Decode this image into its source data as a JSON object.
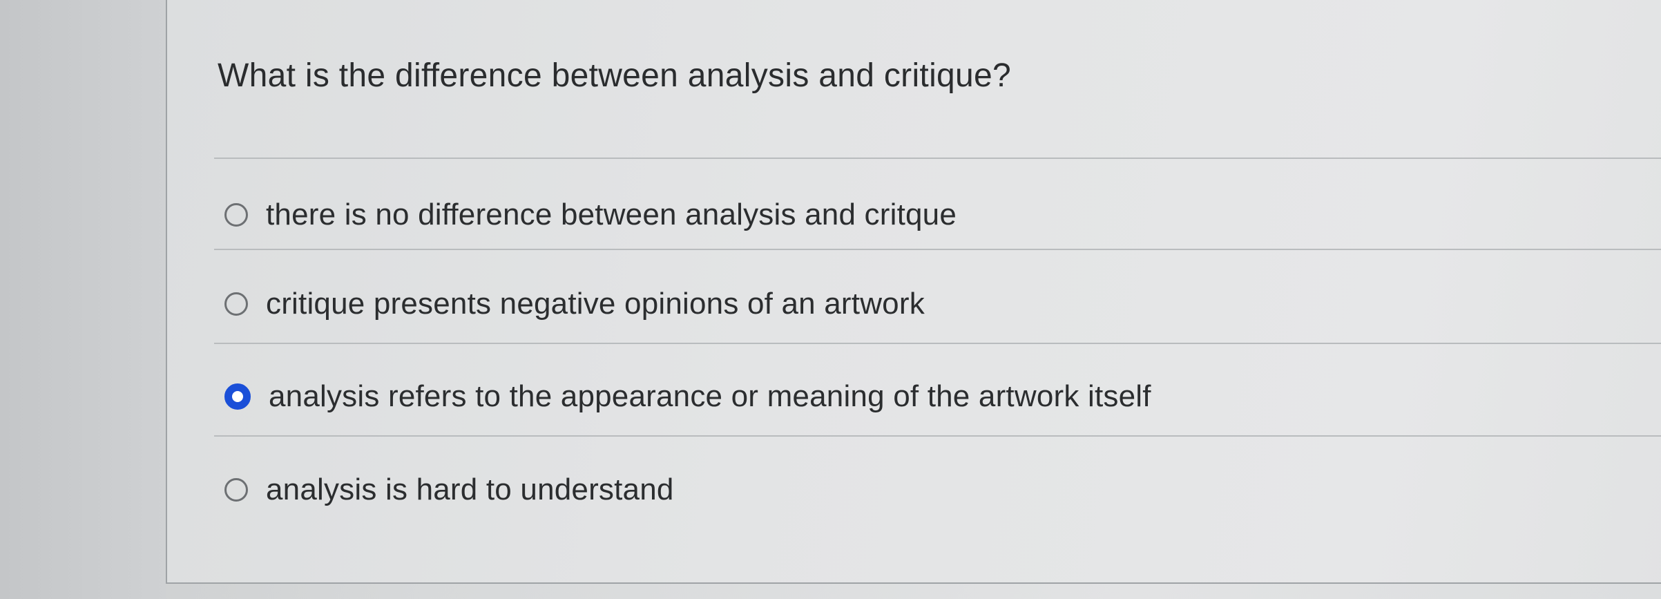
{
  "question": {
    "text": "What is the difference between analysis and critique?"
  },
  "options": [
    {
      "label": "there is no difference between analysis and critque",
      "selected": false
    },
    {
      "label": "critique presents negative opinions of an artwork",
      "selected": false
    },
    {
      "label": "analysis refers to the appearance or meaning of the artwork itself",
      "selected": true
    },
    {
      "label": "analysis is hard to understand",
      "selected": false
    }
  ],
  "colors": {
    "selected_radio": "#1a4fd8",
    "text": "#2b2d2f"
  }
}
